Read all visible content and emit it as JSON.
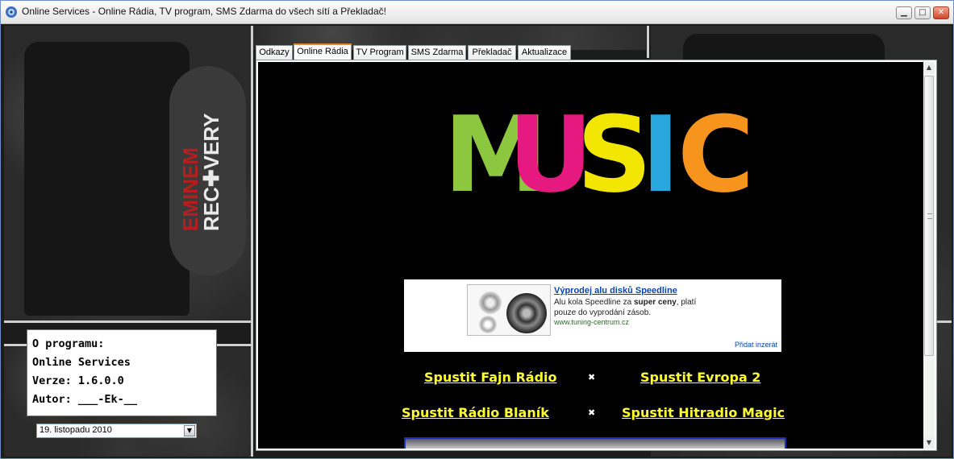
{
  "window": {
    "title": "Online Services - Online Rádia, TV program, SMS Zdarma do všech sítí a Překladač!",
    "controls": {
      "minimize": "▁",
      "maximize": "□",
      "close": "✕"
    }
  },
  "background": {
    "shirt_text_1": "EMINEM",
    "shirt_text_2": "REC✚VERY"
  },
  "info_box": {
    "line1": "O programu:",
    "line2": "Online Services",
    "line3": "Verze: 1.6.0.0",
    "line4": "Autor: ___-Ek-__"
  },
  "date_picker": {
    "value": "19. listopadu 2010",
    "arrow": "▼"
  },
  "tabs": [
    {
      "label": "Odkazy"
    },
    {
      "label": "Online Rádia"
    },
    {
      "label": "TV Program"
    },
    {
      "label": "SMS Zdarma"
    },
    {
      "label": "Překladač"
    },
    {
      "label": "Aktualizace"
    }
  ],
  "active_tab": "Online Rádia",
  "banner": {
    "letters": [
      "M",
      "U",
      "S",
      "I",
      "C"
    ],
    "colors": [
      "#8dc63f",
      "#e5197f",
      "#f2e600",
      "#29a7df",
      "#f7941d"
    ]
  },
  "ad": {
    "headline": "Výprodej alu disků Speedline",
    "body_pre": "Alu kola Speedline za ",
    "body_bold": "super ceny",
    "body_post": ", platí pouze do vyprodání zásob.",
    "url": "www.tuning-centrum.cz",
    "add_link": "Přidat inzerát"
  },
  "radios": {
    "fajn": "Spustit Fajn Rádio",
    "evropa2": "Spustit Evropa 2",
    "blanik": "Spustit Rádio Blaník",
    "magic": "Spustit Hitradio Magic",
    "separator": "✖"
  },
  "scrollbar": {
    "up": "▲",
    "down": "▼"
  }
}
